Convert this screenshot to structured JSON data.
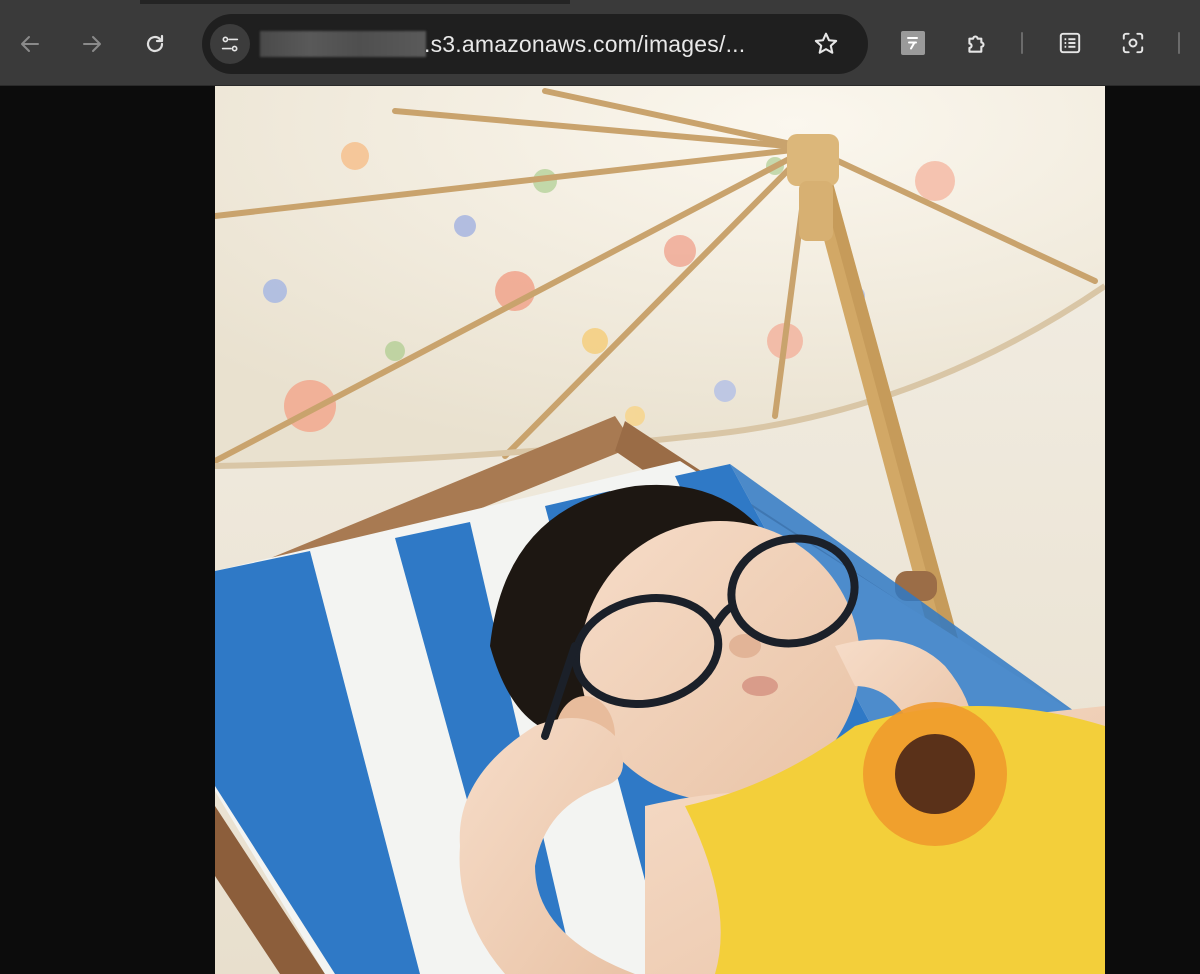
{
  "browser": {
    "url_visible": ".s3.amazonaws.com/images/...",
    "url_prefix_redacted": true,
    "icons": {
      "back": "arrow-left-icon",
      "forward": "arrow-right-icon",
      "reload": "reload-icon",
      "site_info": "tune-icon",
      "bookmark": "star-icon",
      "extension_1": "extension-badge-icon",
      "extensions": "puzzle-icon",
      "reading_list": "reading-list-icon",
      "lens": "screenshot-lens-icon"
    },
    "colors": {
      "toolbar": "#3a3a3a",
      "omnibox": "#1f1f1f",
      "page_background": "#0c0c0c"
    }
  },
  "image": {
    "subject": "baby in sunglasses on a striped beach chair under a floral umbrella"
  }
}
